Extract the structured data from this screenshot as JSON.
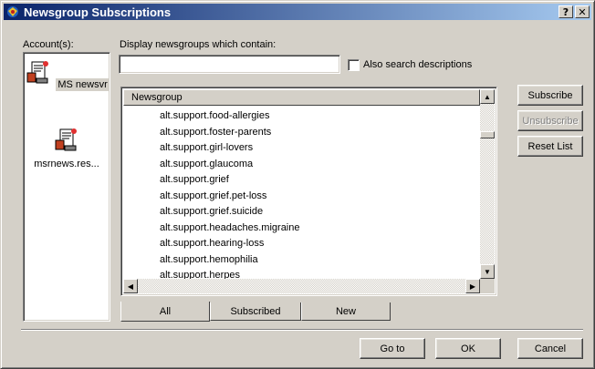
{
  "window": {
    "title": "Newsgroup Subscriptions",
    "help_btn": "?",
    "close_btn": "✕"
  },
  "accounts": {
    "label": "Account(s):",
    "items": [
      {
        "name": "MS newsvr",
        "selected": true,
        "icon": "news-server-icon"
      },
      {
        "name": "msrnews.res...",
        "selected": false,
        "icon": "news-server-icon"
      }
    ]
  },
  "filter": {
    "label": "Display newsgroups which contain:",
    "value": "",
    "checkbox_label": "Also search descriptions",
    "checked": false
  },
  "list": {
    "header": "Newsgroup",
    "rows": [
      "alt.support.food-allergies",
      "alt.support.foster-parents",
      "alt.support.girl-lovers",
      "alt.support.glaucoma",
      "alt.support.grief",
      "alt.support.grief.pet-loss",
      "alt.support.grief.suicide",
      "alt.support.headaches.migraine",
      "alt.support.hearing-loss",
      "alt.support.hemophilia",
      "alt.support.herpes"
    ]
  },
  "tabs": [
    {
      "label": "All",
      "active": true
    },
    {
      "label": "Subscribed",
      "active": false
    },
    {
      "label": "New",
      "active": false
    }
  ],
  "side_buttons": {
    "subscribe": "Subscribe",
    "unsubscribe": "Unsubscribe",
    "reset": "Reset List"
  },
  "bottom_buttons": {
    "goto": "Go to",
    "ok": "OK",
    "cancel": "Cancel"
  },
  "colors": {
    "title_start": "#0a246a",
    "title_end": "#a6caf0",
    "face": "#d4d0c8"
  }
}
